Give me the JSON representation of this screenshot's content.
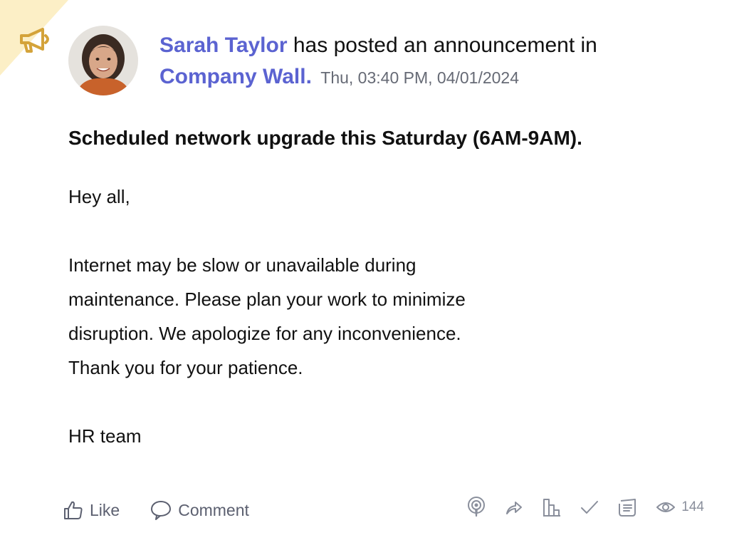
{
  "post": {
    "author": "Sarah Taylor",
    "action_text": "has posted an announcement in",
    "channel": "Company Wall.",
    "timestamp": "Thu, 03:40 PM, 04/01/2024",
    "title": "Scheduled network upgrade this Saturday (6AM-9AM).",
    "body_lines": [
      "Hey all,",
      "",
      "Internet may be slow or unavailable during",
      "maintenance. Please plan your work to minimize",
      "disruption. We apologize for any inconvenience.",
      "Thank you for your patience.",
      "",
      "HR team"
    ]
  },
  "actions": {
    "like_label": "Like",
    "comment_label": "Comment"
  },
  "stats": {
    "views": "144"
  },
  "icons": [
    "megaphone-icon",
    "thumbs-up-icon",
    "comment-icon",
    "podcast-icon",
    "share-icon",
    "chart-icon",
    "check-icon",
    "notes-icon",
    "eye-icon"
  ],
  "colors": {
    "link": "#5b63d1",
    "corner": "#fcefc6",
    "megaphone": "#d4a33a",
    "icon_gray": "#8a8f9c"
  }
}
